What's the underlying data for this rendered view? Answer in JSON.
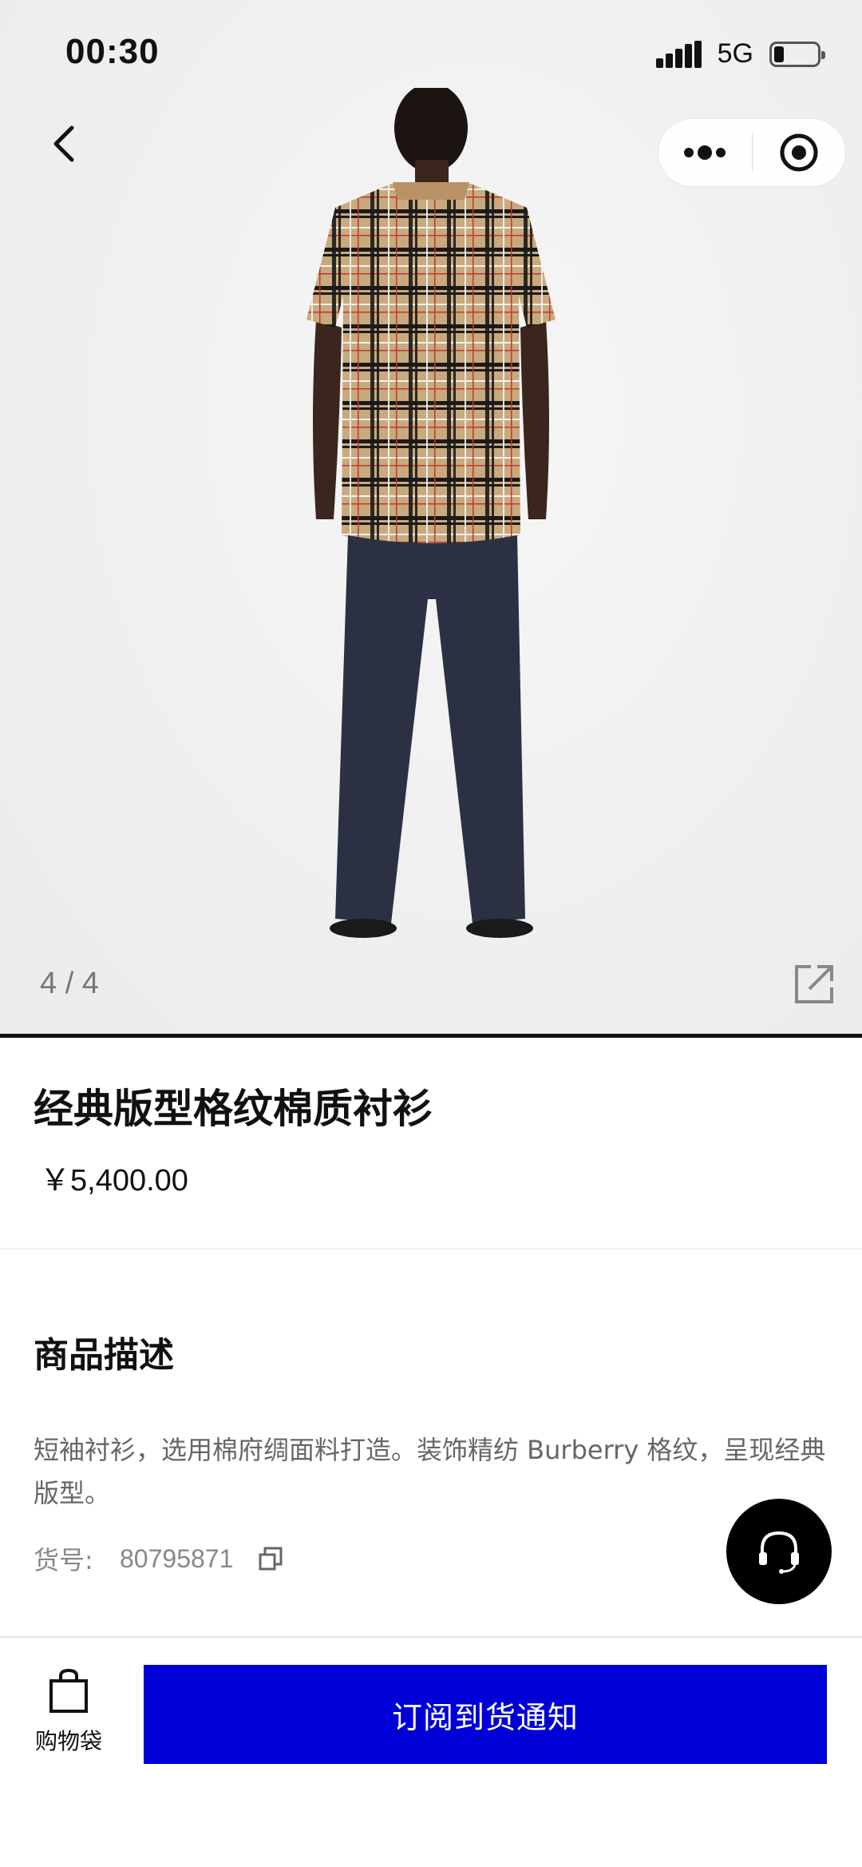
{
  "status_bar": {
    "time": "00:30",
    "network": "5G",
    "icons": [
      "signal-icon",
      "battery-icon"
    ]
  },
  "nav": {
    "icons": [
      "back-arrow-icon",
      "more-dots-icon",
      "close-target-icon"
    ]
  },
  "gallery": {
    "counter": "4 / 4",
    "icons": [
      "share-external-icon"
    ]
  },
  "product": {
    "title": "经典版型格纹棉质衬衫",
    "price": "￥5,400.00"
  },
  "description": {
    "heading": "商品描述",
    "text": "短袖衬衫，选用棉府绸面料打造。装饰精纺 Burberry 格纹，呈现经典版型。",
    "sku_label": "货号:",
    "sku_value": "80795871",
    "icons": [
      "copy-icon",
      "headset-support-icon"
    ]
  },
  "bottom_bar": {
    "bag_label": "购物袋",
    "notify_label": "订阅到货通知",
    "icons": [
      "shopping-bag-icon"
    ]
  },
  "colors": {
    "accent_button": "#0000d6",
    "support_button": "#000000",
    "hero_background": "#efefef"
  }
}
